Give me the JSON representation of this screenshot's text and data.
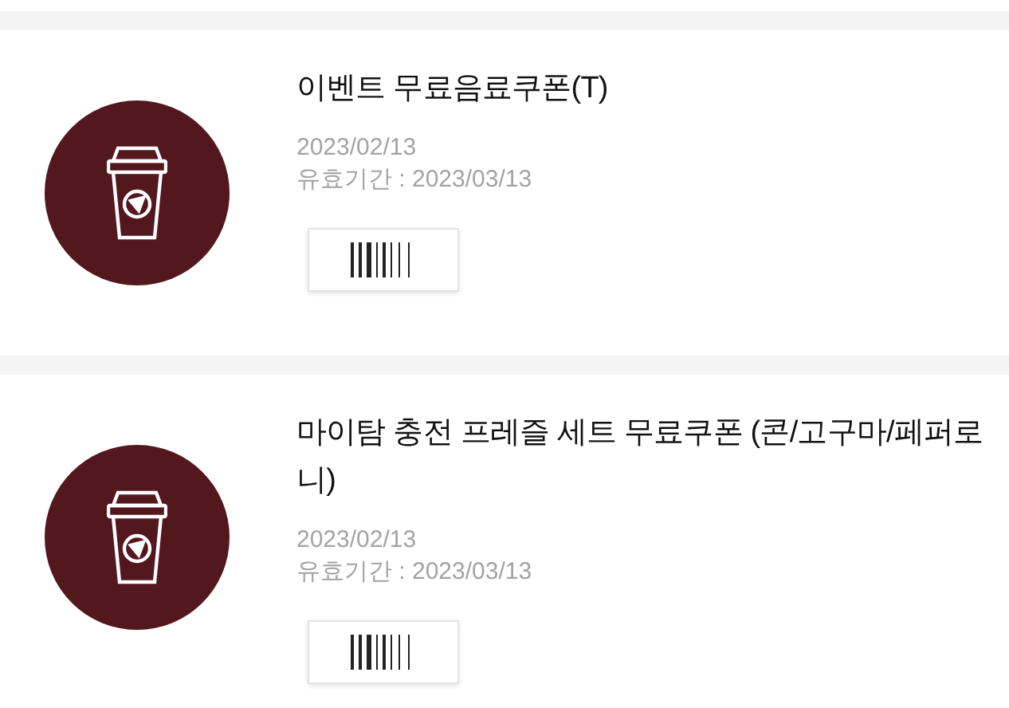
{
  "coupons": [
    {
      "title": "이벤트 무료음료쿠폰(T)",
      "issued": "2023/02/13",
      "validity": "유효기간 : 2023/03/13"
    },
    {
      "title": "마이탐 충전 프레즐 세트 무료쿠폰 (콘/고구마/페퍼로니)",
      "issued": "2023/02/13",
      "validity": "유효기간 : 2023/03/13"
    }
  ]
}
